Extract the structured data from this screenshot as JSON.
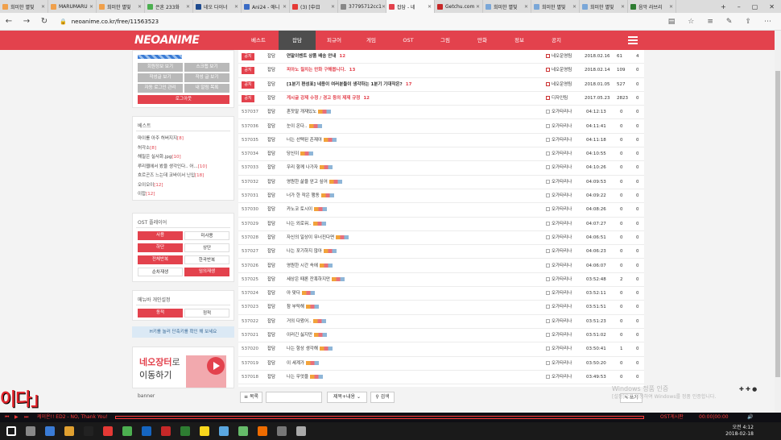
{
  "browser": {
    "tabs": [
      {
        "label": "희미한 별빛",
        "color": "#f0a04b"
      },
      {
        "label": "MARUMARU",
        "color": "#f0a04b"
      },
      {
        "label": "희미한 별빛",
        "color": "#f0a04b"
      },
      {
        "label": "은혼 233화",
        "color": "#4caf50"
      },
      {
        "label": "네오 다이너",
        "color": "#1e4b8f"
      },
      {
        "label": "Ani24 - 애니",
        "color": "#3a6bc5"
      },
      {
        "label": "(3) [中日",
        "color": "#e53935"
      },
      {
        "label": "37795712cc1",
        "color": "#888888"
      },
      {
        "label": "잡담 - 네",
        "color": "#e3424d"
      },
      {
        "label": "Getchu.com",
        "color": "#c62828"
      },
      {
        "label": "희미한 별빛",
        "color": "#7aa7d8"
      },
      {
        "label": "희미한 별빛",
        "color": "#7aa7d8"
      },
      {
        "label": "희미한 별빛",
        "color": "#7aa7d8"
      },
      {
        "label": "음악 라브리",
        "color": "#2e7d32"
      }
    ],
    "url": "neoanime.co.kr/free/11563523"
  },
  "site": {
    "logo": "NEOANIME",
    "nav": [
      "베스트",
      "잡담",
      "피규어",
      "게임",
      "OST",
      "그림",
      "만화",
      "정보",
      "공지"
    ],
    "active_nav": "잡담"
  },
  "sidebar": {
    "user_buttons": [
      "회원정보 보기",
      "스크랩 보기",
      "작성글 보기",
      "작성 글 보기",
      "자동 로그인 관리",
      "내 알림 목록"
    ],
    "logout": "로그아웃",
    "best_title": "베스트",
    "best_items": [
      {
        "title": "마이를 아주 허버지지",
        "count": "[8]"
      },
      {
        "title": "허각소",
        "count": "[8]"
      },
      {
        "title": "해질은 실사화.jpg",
        "count": "[10]"
      },
      {
        "title": "루리웹에서 봤을 생각인다.. 어...",
        "count": "[10]"
      },
      {
        "title": "흐르곤즈 느는데 코바이서 닌입",
        "count": "[18]"
      },
      {
        "title": "오이오이",
        "count": "[12]"
      },
      {
        "title": "이잡",
        "count": "[12]"
      }
    ],
    "ost_title": "OST 플레이어",
    "ost_buttons": [
      "사용",
      "미사용",
      "하단",
      "상단",
      "전체반복",
      "한곡반복",
      "순차재생",
      "임의재생"
    ],
    "menu_title": "메뉴바 개인설정",
    "menu_buttons": [
      "동적",
      "정적"
    ],
    "hotkey": "H키를 눌러 단축키를 확인 해 보세요",
    "ad_line1": "네오장터",
    "ad_line1b": "로",
    "ad_line2": "이동하기",
    "banner": "banner"
  },
  "board": {
    "notices": [
      {
        "badge": "공지",
        "cat": "잡담",
        "title": "연말이벤트 상품 배송 안내",
        "comments": "12",
        "author": "네오운영팀",
        "date": "2018.02.16",
        "views": "61",
        "likes": "4",
        "red": false
      },
      {
        "badge": "공지",
        "cat": "잡담",
        "title": "피아노 칠치는 만화 구해봅니다.",
        "comments": "13",
        "author": "네오운영팀",
        "date": "2018.02.14",
        "views": "109",
        "likes": "0",
        "red": true
      },
      {
        "badge": "공지",
        "cat": "잡담",
        "title": "[1분기 편성표] 네용이 여러분들이 생각하는 1분기 기대작은?",
        "comments": "17",
        "author": "네오운영팀",
        "date": "2018.01.05",
        "views": "527",
        "likes": "0",
        "red": false
      },
      {
        "badge": "공지",
        "cat": "잡담",
        "title": "게시글 강제 수정 / 경고 등의 제재 규정",
        "comments": "12",
        "author": "디자인팀",
        "date": "2017.05.23",
        "views": "2823",
        "likes": "0",
        "red": true
      }
    ],
    "rows": [
      {
        "no": "537037",
        "cat": "잡담",
        "title": "혼잣말 개재있노",
        "author": "오가타리나",
        "time": "04:12:13",
        "views": "0",
        "likes": "0"
      },
      {
        "no": "537036",
        "cat": "잡담",
        "title": "눈이 온다..",
        "author": "오가타리나",
        "time": "04:11:41",
        "views": "0",
        "likes": "0"
      },
      {
        "no": "537035",
        "cat": "잡담",
        "title": "너는 선택된 존재야",
        "author": "오가타리나",
        "time": "04:11:18",
        "views": "0",
        "likes": "0"
      },
      {
        "no": "537034",
        "cat": "잡담",
        "title": "당신이",
        "author": "오가타리나",
        "time": "04:10:55",
        "views": "0",
        "likes": "0"
      },
      {
        "no": "537033",
        "cat": "잡담",
        "title": "우리 함께 나가자",
        "author": "오가타리나",
        "time": "04:10:26",
        "views": "0",
        "likes": "0"
      },
      {
        "no": "537032",
        "cat": "잡담",
        "title": "영원한 삶을 얻고 싶어",
        "author": "오가타리나",
        "time": "04:09:53",
        "views": "0",
        "likes": "0"
      },
      {
        "no": "537031",
        "cat": "잡담",
        "title": "너가 한 작은 행동",
        "author": "오가타리나",
        "time": "04:09:22",
        "views": "0",
        "likes": "0"
      },
      {
        "no": "537030",
        "cat": "잡담",
        "title": "카노코 토시이",
        "author": "오가타리나",
        "time": "04:08:26",
        "views": "0",
        "likes": "0"
      },
      {
        "no": "537029",
        "cat": "잡담",
        "title": "나는 외로워..",
        "author": "오가타리나",
        "time": "04:07:27",
        "views": "0",
        "likes": "0"
      },
      {
        "no": "537028",
        "cat": "잡담",
        "title": "자신의 일상이 무너진다면",
        "author": "오가타리나",
        "time": "04:06:51",
        "views": "0",
        "likes": "0"
      },
      {
        "no": "537027",
        "cat": "잡담",
        "title": "나는 포기하지 않아",
        "author": "오가타리나",
        "time": "04:06:23",
        "views": "0",
        "likes": "0"
      },
      {
        "no": "537026",
        "cat": "잡담",
        "title": "영원한 시간 속에",
        "author": "오가타리나",
        "time": "04:06:07",
        "views": "0",
        "likes": "0"
      },
      {
        "no": "537025",
        "cat": "잡담",
        "title": "세상은 때론 잔혹하지만",
        "author": "오가타리나",
        "time": "03:52:48",
        "views": "2",
        "likes": "0"
      },
      {
        "no": "537024",
        "cat": "잡담",
        "title": "아 맞다",
        "author": "오가타리나",
        "time": "03:52:11",
        "views": "0",
        "likes": "0"
      },
      {
        "no": "537023",
        "cat": "잡담",
        "title": "참 부탁해",
        "author": "오가타리나",
        "time": "03:51:51",
        "views": "0",
        "likes": "0"
      },
      {
        "no": "537022",
        "cat": "잡담",
        "title": "거의 다왔어..",
        "author": "오가타리나",
        "time": "03:51:23",
        "views": "0",
        "likes": "0"
      },
      {
        "no": "537021",
        "cat": "잡담",
        "title": "이러긴 싫지만",
        "author": "오가타리나",
        "time": "03:51:02",
        "views": "0",
        "likes": "0"
      },
      {
        "no": "537020",
        "cat": "잡담",
        "title": "나는 항상 생각해",
        "author": "오가타리나",
        "time": "03:50:41",
        "views": "1",
        "likes": "0"
      },
      {
        "no": "537019",
        "cat": "잡담",
        "title": "이 세계가",
        "author": "오가타리나",
        "time": "03:50:20",
        "views": "0",
        "likes": "0"
      },
      {
        "no": "537018",
        "cat": "잡담",
        "title": "나는 무엇을",
        "author": "오가타리나",
        "time": "03:49:53",
        "views": "0",
        "likes": "0"
      }
    ],
    "search": {
      "list_label": "목록",
      "select_value": "제목+내용",
      "search_label": "검색",
      "write_label": "쓰기"
    }
  },
  "overlay": {
    "lyric": "이다」",
    "watermark": "Windows 정품 인증",
    "watermark_sub": "[설정]으로 이동하여 Windows를 정품 인증합니다.",
    "sticky": "✚ ✚ ●"
  },
  "player": {
    "now_playing": "케이온!! ED2 - NO, Thank You!",
    "ost_label": "OST게시판",
    "time": "00:00|00:00"
  },
  "taskbar": {
    "time": "오전 4:12",
    "date": "2018-02-18"
  }
}
